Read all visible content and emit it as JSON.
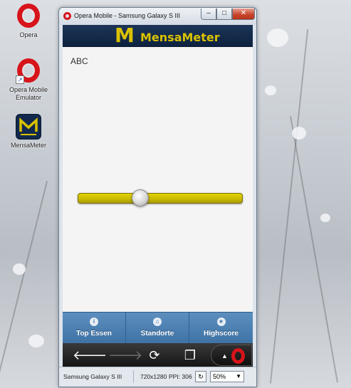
{
  "desktop": {
    "icons": [
      {
        "label": "Opera"
      },
      {
        "label": "Opera Mobile Emulator"
      },
      {
        "label": "MensaMeter"
      }
    ]
  },
  "window": {
    "title": "Opera Mobile - Samsung Galaxy S III",
    "controls": {
      "minimize": "–",
      "maximize": "□",
      "close": "✕"
    }
  },
  "app": {
    "logo": "M",
    "title": "MensaMeter",
    "content_label": "ABC",
    "slider": {
      "value_fraction": 0.38
    },
    "nav": [
      {
        "label": "Top Essen",
        "icon": "info-icon"
      },
      {
        "label": "Standorte",
        "icon": "home-icon"
      },
      {
        "label": "Highscore",
        "icon": "star-icon"
      }
    ]
  },
  "browser_toolbar": {
    "back": "🡐",
    "forward": "🡒",
    "reload": "⟳",
    "tabs": "❐"
  },
  "statusbar": {
    "device": "Samsung Galaxy S III",
    "resolution": "720x1280",
    "ppi": "PPI: 306",
    "zoom": "50%"
  },
  "colors": {
    "header": "#0d223f",
    "accent_yellow": "#d9c100",
    "nav_blue": "#4a7eb1",
    "opera_red": "#d7141a"
  }
}
